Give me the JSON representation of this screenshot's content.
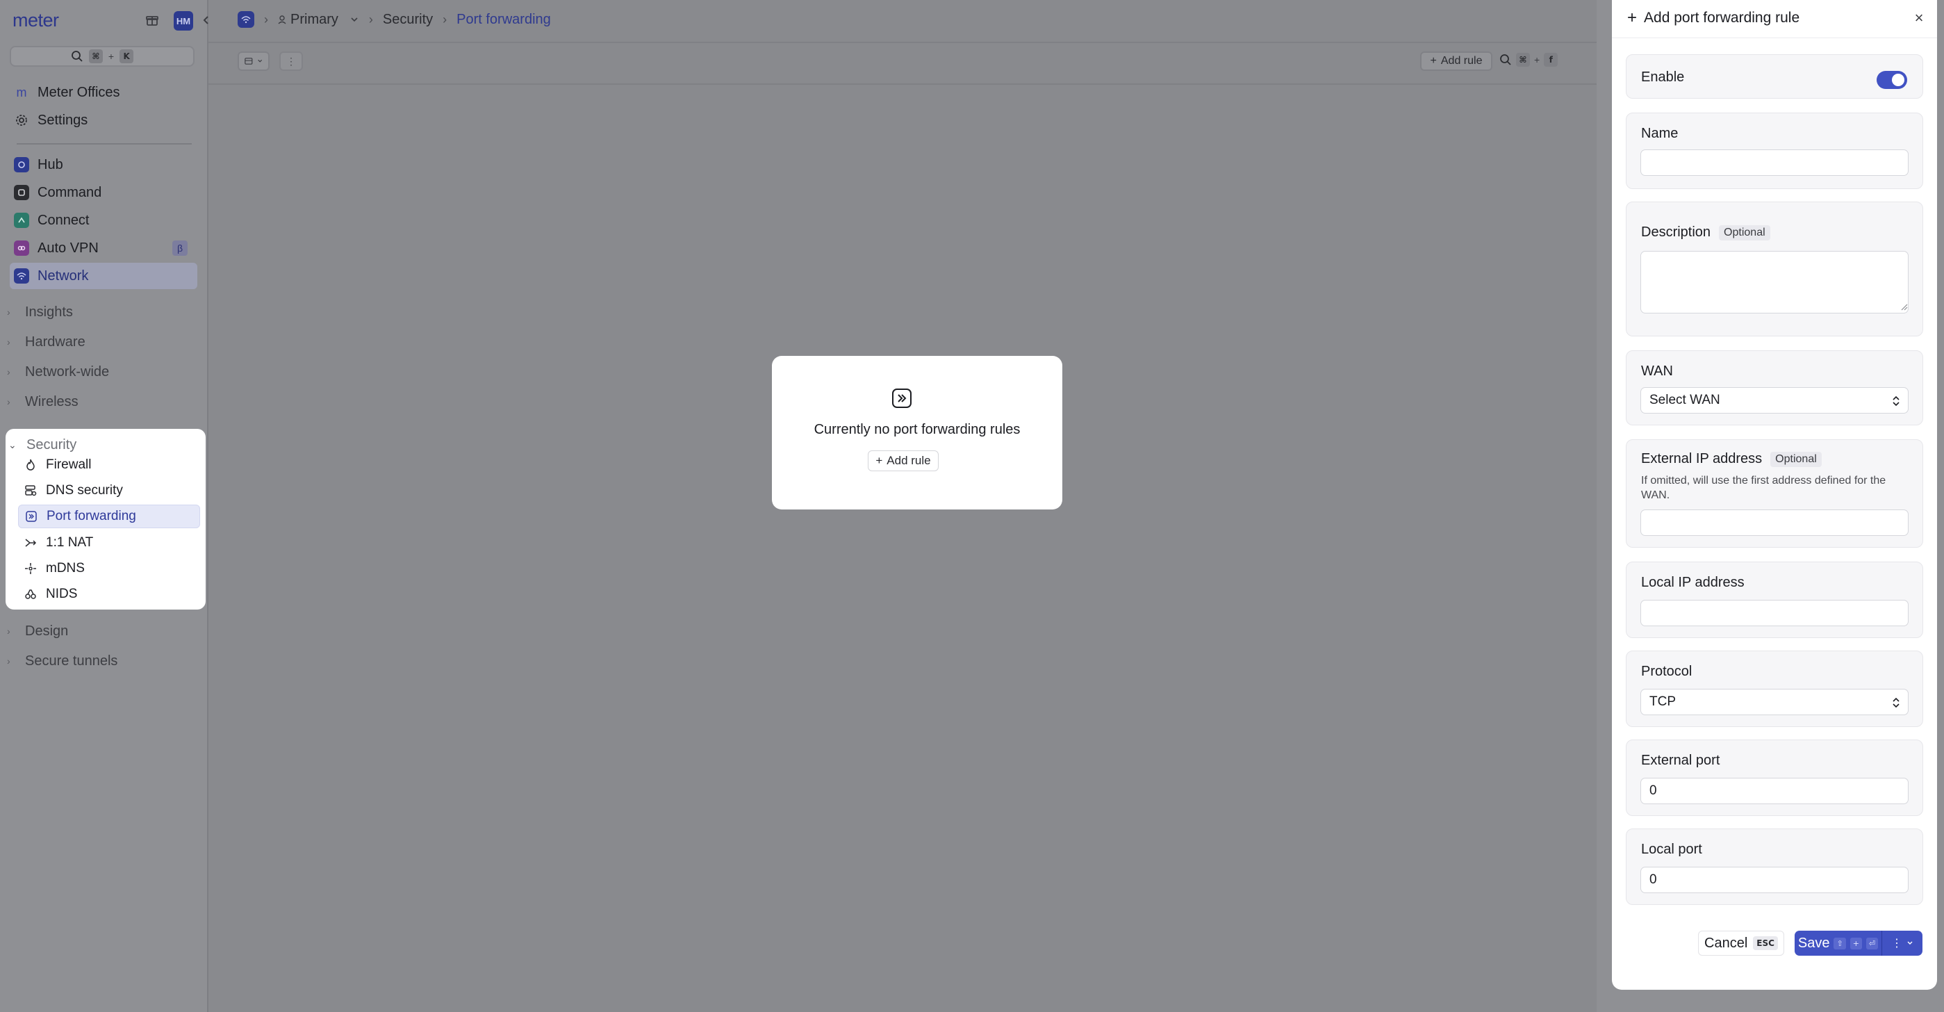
{
  "sidebar": {
    "logo": "meter",
    "avatar": "HM",
    "search_keys": [
      "⌘",
      "K"
    ],
    "primary_items": [
      {
        "label": "Meter Offices",
        "icon": "m"
      },
      {
        "label": "Settings",
        "icon": "gear-icon"
      }
    ],
    "products": [
      {
        "label": "Hub",
        "color": "#2c3a8f"
      },
      {
        "label": "Command",
        "color": "#2b2c30"
      },
      {
        "label": "Connect",
        "color": "#2b7a6a"
      },
      {
        "label": "Auto VPN",
        "color": "#7a3c8a",
        "badge": "β"
      },
      {
        "label": "Network",
        "color": "#2e3b8f",
        "active": true
      }
    ],
    "groups": [
      {
        "label": "Insights"
      },
      {
        "label": "Hardware"
      },
      {
        "label": "Network-wide"
      },
      {
        "label": "Wireless"
      }
    ],
    "security": {
      "label": "Security",
      "items": [
        {
          "label": "Firewall",
          "icon": "flame-icon"
        },
        {
          "label": "DNS security",
          "icon": "dns-icon"
        },
        {
          "label": "Port forwarding",
          "icon": "port-forward-icon",
          "active": true
        },
        {
          "label": "1:1 NAT",
          "icon": "nat-icon"
        },
        {
          "label": "mDNS",
          "icon": "mdns-icon"
        },
        {
          "label": "NIDS",
          "icon": "nids-icon"
        }
      ]
    },
    "groups_after": [
      {
        "label": "Design"
      },
      {
        "label": "Secure tunnels"
      }
    ]
  },
  "header": {
    "breadcrumbs": [
      "Primary",
      "Security",
      "Port forwarding"
    ]
  },
  "toolbar": {
    "add_rule": "Add rule",
    "search_keys": [
      "⌘",
      "f"
    ]
  },
  "empty_state": {
    "message": "Currently no port forwarding rules",
    "add_rule": "Add rule"
  },
  "drawer": {
    "title": "Add port forwarding rule",
    "enable_label": "Enable",
    "enabled": true,
    "name_label": "Name",
    "name_value": "",
    "description_label": "Description",
    "optional_tag": "Optional",
    "description_value": "",
    "wan_label": "WAN",
    "wan_value": "Select WAN",
    "external_ip_label": "External IP address",
    "external_ip_hint": "If omitted, will use the first address defined for the WAN.",
    "external_ip_value": "",
    "local_ip_label": "Local IP address",
    "local_ip_value": "",
    "protocol_label": "Protocol",
    "protocol_value": "TCP",
    "external_port_label": "External port",
    "external_port_value": "0",
    "local_port_label": "Local port",
    "local_port_value": "0",
    "cancel_label": "Cancel",
    "cancel_key": "ESC",
    "save_label": "Save",
    "save_keys": [
      "⇧",
      "+",
      "⏎"
    ]
  },
  "colors": {
    "accent": "#4152c3",
    "brand": "#2d378c"
  }
}
